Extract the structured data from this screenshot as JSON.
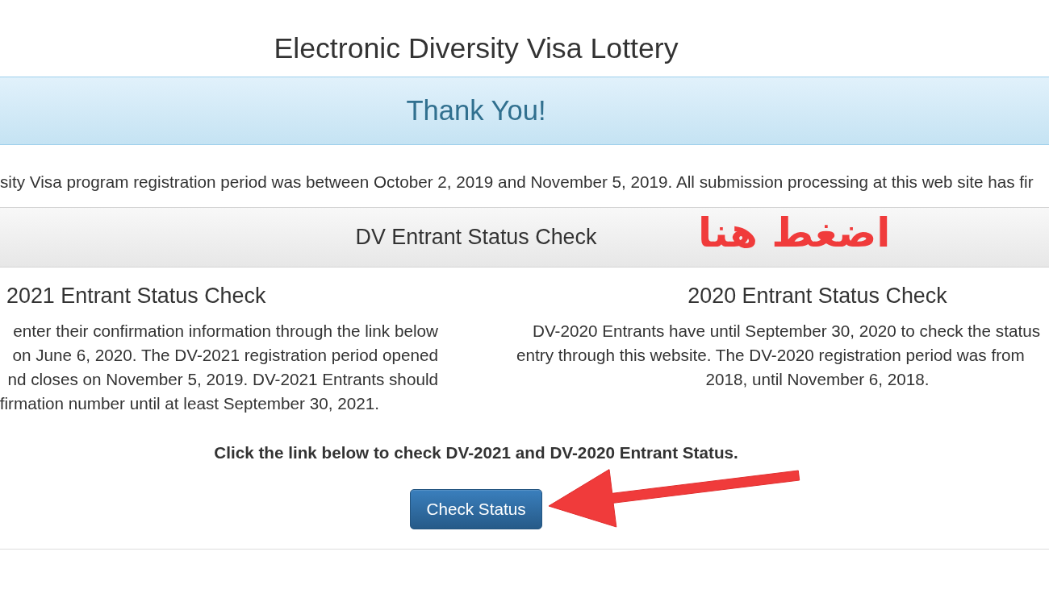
{
  "page_title": "Electronic Diversity Visa Lottery",
  "banner": {
    "title": "Thank You!"
  },
  "notice": "sity Visa program registration period was between October 2, 2019 and November 5, 2019. All submission processing at this web site has fir",
  "status_check": {
    "title": "DV Entrant Status Check",
    "columns": [
      {
        "heading": "2021 Entrant Status Check",
        "lines": [
          "enter their confirmation information through the link below",
          "on June 6, 2020. The DV-2021 registration period opened",
          "nd closes on November 5, 2019. DV-2021 Entrants should",
          "firmation number until at least September 30, 2021."
        ]
      },
      {
        "heading": "2020 Entrant Status Check",
        "lines": [
          "DV-2020 Entrants have until September 30, 2020 to check the status",
          "entry through this website. The DV-2020 registration period was from",
          "2018, until November 6, 2018."
        ]
      }
    ],
    "instruction": "Click the link below to check DV-2021 and DV-2020 Entrant Status.",
    "button": "Check Status"
  },
  "annotation": {
    "text": "اضغط هنا"
  }
}
